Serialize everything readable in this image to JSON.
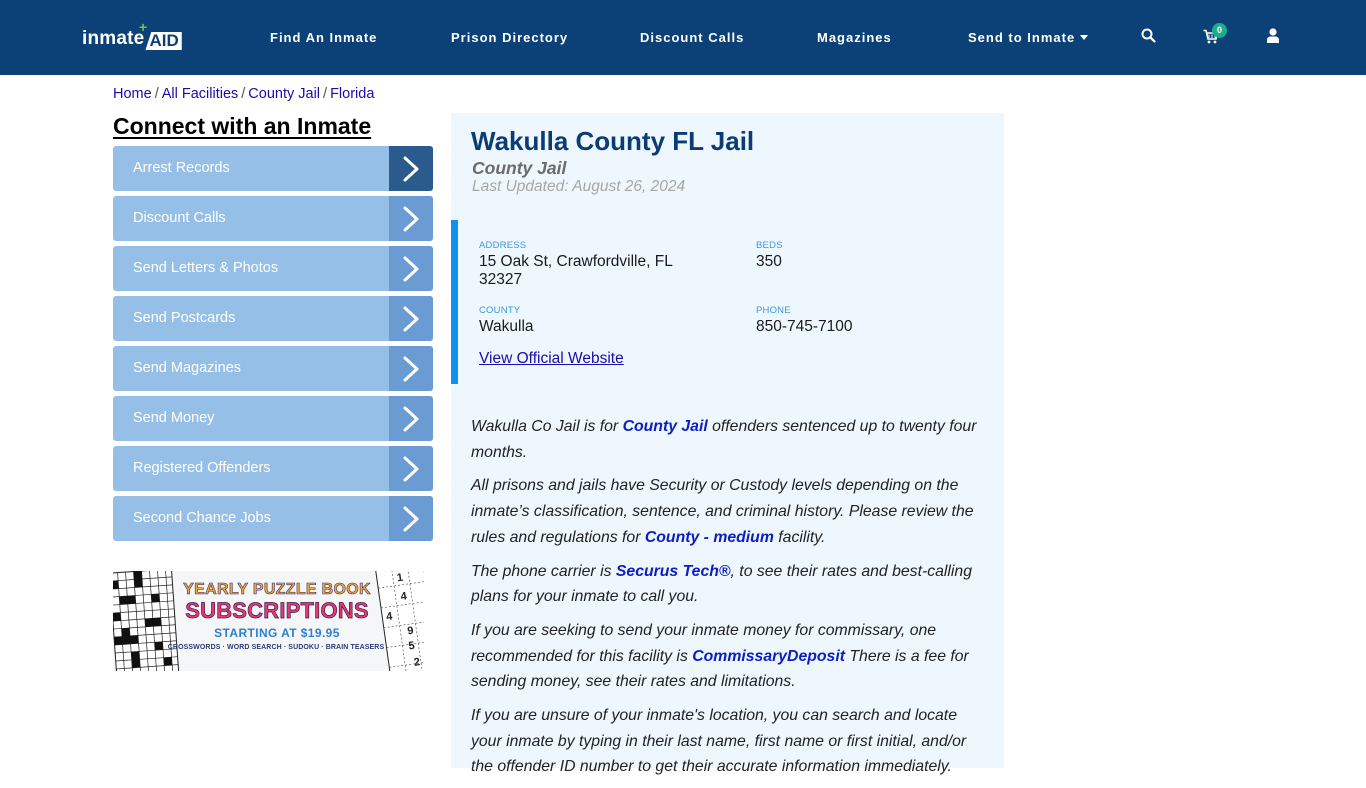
{
  "brand": {
    "logo_left": "inmate",
    "logo_right": "AID",
    "logo_plus": "+"
  },
  "nav": {
    "links": [
      "Find An Inmate",
      "Prison Directory",
      "Discount Calls",
      "Magazines",
      "Send to Inmate"
    ],
    "cart_count": "0",
    "icons": [
      "search-icon",
      "cart-icon",
      "user-icon"
    ]
  },
  "breadcrumb": {
    "items": [
      "Home",
      "All Facilities",
      "County Jail",
      "Florida"
    ],
    "separator": "/"
  },
  "sidebar": {
    "title": "Connect with an Inmate",
    "items": [
      {
        "label": "Arrest Records"
      },
      {
        "label": "Discount Calls"
      },
      {
        "label": "Send Letters & Photos"
      },
      {
        "label": "Send Postcards"
      },
      {
        "label": "Send Magazines"
      },
      {
        "label": "Send Money"
      },
      {
        "label": "Registered Offenders"
      },
      {
        "label": "Second Chance Jobs"
      }
    ],
    "ad": {
      "line1": "YEARLY PUZZLE BOOK",
      "line2": "SUBSCRIPTIONS",
      "line3": "STARTING AT $19.95",
      "line4": "CROSSWORDS · WORD SEARCH · SUDOKU · BRAIN TEASERS",
      "sudoku_digits": [
        "1",
        "4",
        "4",
        "9",
        "5",
        "2"
      ]
    }
  },
  "facility": {
    "title": "Wakulla County FL Jail",
    "type": "County Jail",
    "last_updated": "Last Updated: August 26, 2024",
    "address_label": "ADDRESS",
    "address_line1": "15 Oak St, Crawfordville, FL",
    "address_line2": "32327",
    "beds_label": "BEDS",
    "beds": "350",
    "county_label": "COUNTY",
    "county": "Wakulla",
    "phone_label": "PHONE",
    "phone": "850-745-7100",
    "website_link": "View Official Website"
  },
  "description": {
    "p1_a": "Wakulla Co Jail is for ",
    "p1_link": "County Jail",
    "p1_b": " offenders sentenced up to twenty four months.",
    "p2_a": "All prisons and jails have Security or Custody levels depending on the inmate’s classification, sentence, and criminal history. Please review the rules and regulations for ",
    "p2_link": "County - medium",
    "p2_b": " facility.",
    "p3_a": "The phone carrier is ",
    "p3_link": "Securus Tech®",
    "p3_b": ", to see their rates and best-calling plans for your inmate to call you.",
    "p4_a": "If you are seeking to send your inmate money for commissary, one recommended for this facility is ",
    "p4_link": "CommissaryDeposit",
    "p4_b": " There is a fee for sending money, see their rates and limitations.",
    "p5": "If you are unsure of your inmate's location, you can search and locate your inmate by typing in their last name, first name or first initial, and/or the offender ID number to get their accurate information immediately."
  }
}
